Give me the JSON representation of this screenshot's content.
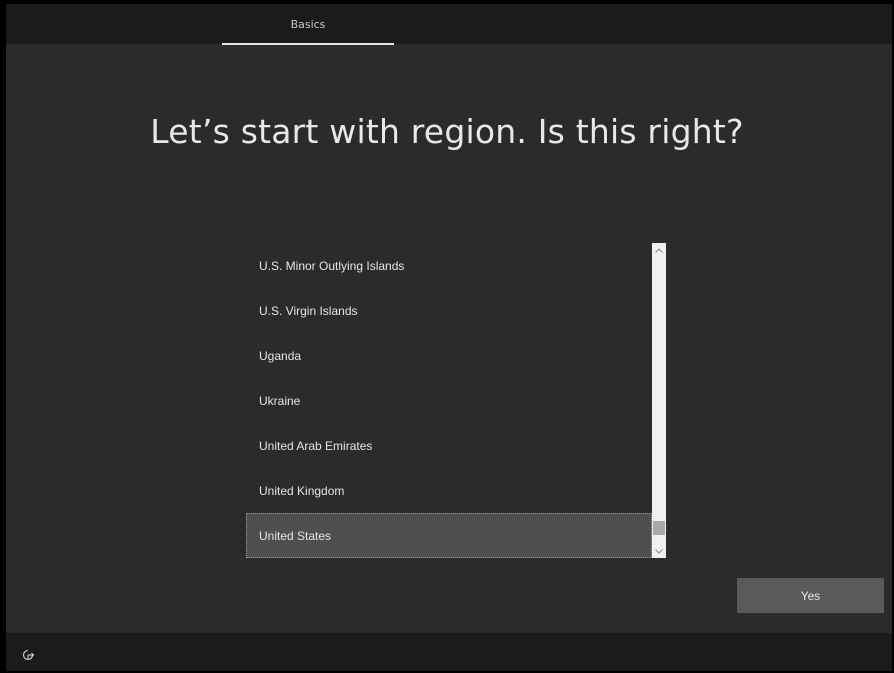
{
  "header": {
    "tab_label": "Basics"
  },
  "main": {
    "title": "Let’s start with region. Is this right?"
  },
  "region_list": {
    "items": [
      {
        "label": "U.S. Minor Outlying Islands"
      },
      {
        "label": "U.S. Virgin Islands"
      },
      {
        "label": "Uganda"
      },
      {
        "label": "Ukraine"
      },
      {
        "label": "United Arab Emirates"
      },
      {
        "label": "United Kingdom"
      },
      {
        "label": "United States"
      }
    ],
    "selected_value": "United States",
    "scroll_position": 0.93
  },
  "actions": {
    "yes_label": "Yes"
  },
  "footer": {
    "icon": "accessibility-icon"
  },
  "colors": {
    "background": "#2b2b2b",
    "bar": "#1b1b1b",
    "selected": "#4f4f4f",
    "button": "#5a5a5a"
  }
}
